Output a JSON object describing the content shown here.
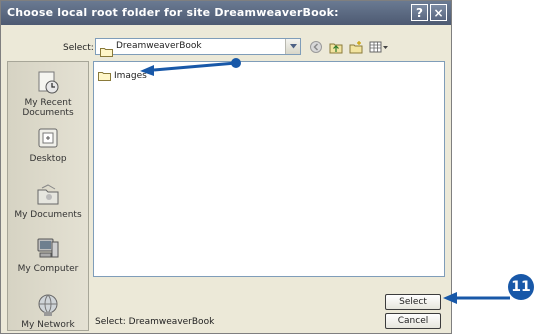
{
  "dialog": {
    "title": "Choose local root folder for site DreamweaverBook:",
    "help_button": "?",
    "close_button": "×"
  },
  "toolbar": {
    "select_label": "Select:",
    "current_folder": "DreamweaverBook"
  },
  "places": [
    {
      "label": "My Recent Documents",
      "icon": "recent-documents-icon"
    },
    {
      "label": "Desktop",
      "icon": "desktop-icon"
    },
    {
      "label": "My Documents",
      "icon": "my-documents-icon"
    },
    {
      "label": "My Computer",
      "icon": "my-computer-icon"
    },
    {
      "label": "My Network",
      "icon": "my-network-icon"
    }
  ],
  "files": [
    {
      "name": "Images",
      "icon": "folder-icon"
    }
  ],
  "status": {
    "text": "Select: DreamweaverBook"
  },
  "buttons": {
    "select": "Select",
    "cancel": "Cancel"
  },
  "callout": {
    "step_number": "11",
    "color": "#1858a8"
  }
}
